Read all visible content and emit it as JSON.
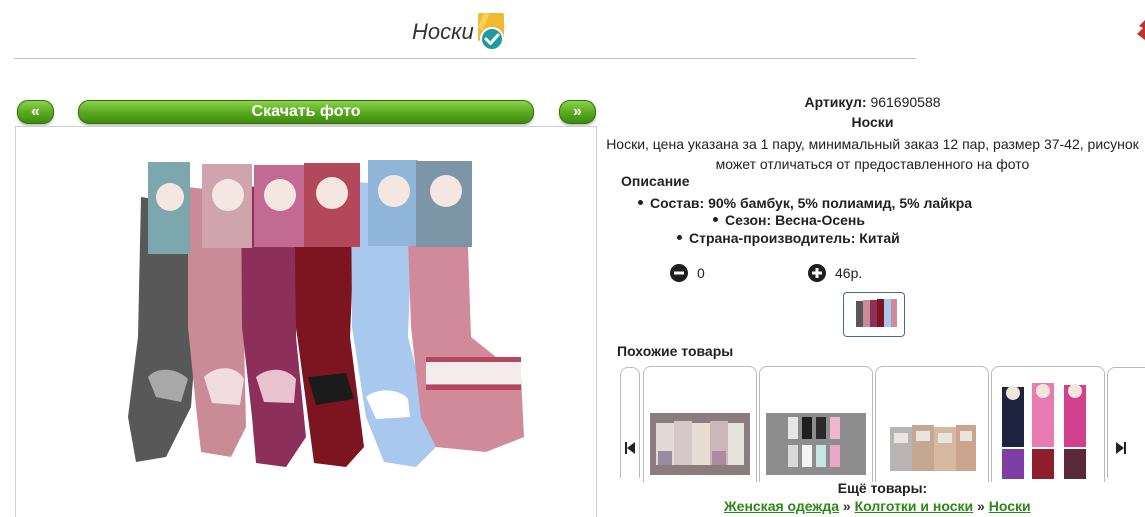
{
  "header": {
    "title": "Носки",
    "verified_icon": "verified-badge-icon"
  },
  "gallery": {
    "prev_label": "«",
    "download_label": "Скачать фото",
    "next_label": "»"
  },
  "product": {
    "article_label": "Артикул:",
    "article_value": "961690588",
    "name": "Носки",
    "description_line1": "Носки, цена указана за 1 пару, минимальный заказ 12 пар, размер 37-42, рисунок",
    "description_line2": "может отличаться от предоставленного на фото"
  },
  "specs": {
    "heading": "Описание",
    "items": [
      "Состав: 90% бамбук, 5% полиамид, 5% лайкра",
      "Сезон: Весна-Осень",
      "Страна-производитель: Китай"
    ]
  },
  "order": {
    "quantity": "0",
    "price": "46р.",
    "minus_icon": "minus-circle-icon",
    "plus_icon": "plus-circle-icon"
  },
  "similar": {
    "heading": "Похожие товары",
    "prev_icon": "skip-back-icon",
    "next_icon": "skip-forward-icon"
  },
  "more": {
    "heading": "Ещё товары:",
    "breadcrumb": [
      "Женская одежда",
      "Колготки и носки",
      "Носки"
    ],
    "separator": "»"
  },
  "colors": {
    "button_green": "#58a81e",
    "link_green": "#2a8a16",
    "badge_yellow": "#f2b830",
    "badge_teal": "#1e9aa0"
  }
}
